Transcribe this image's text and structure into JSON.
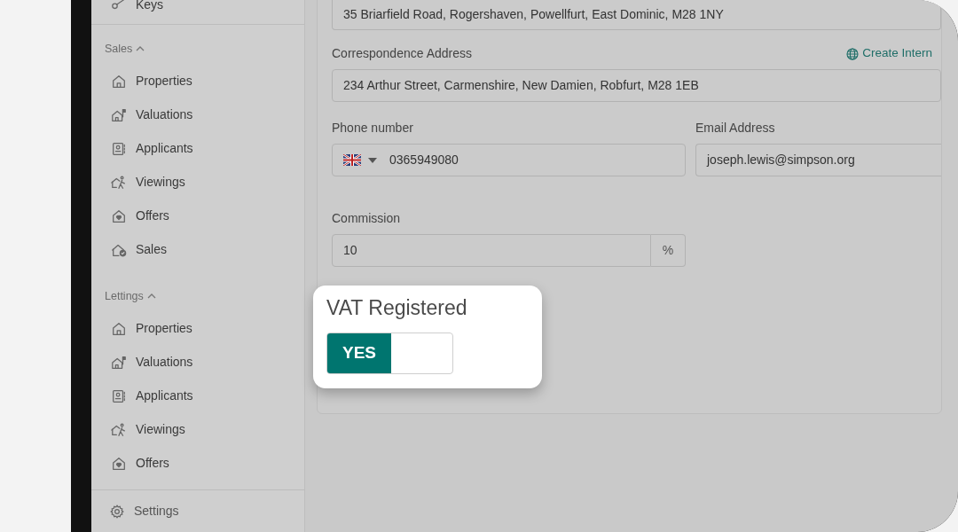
{
  "sidebar": {
    "top_item": {
      "label": "Keys"
    },
    "sections": [
      {
        "title": "Sales",
        "expanded": true,
        "items": [
          {
            "label": "Properties"
          },
          {
            "label": "Valuations"
          },
          {
            "label": "Applicants"
          },
          {
            "label": "Viewings"
          },
          {
            "label": "Offers"
          },
          {
            "label": "Sales"
          }
        ]
      },
      {
        "title": "Lettings",
        "expanded": true,
        "items": [
          {
            "label": "Properties"
          },
          {
            "label": "Valuations"
          },
          {
            "label": "Applicants"
          },
          {
            "label": "Viewings"
          },
          {
            "label": "Offers"
          }
        ]
      }
    ],
    "footer": {
      "label": "Settings"
    }
  },
  "form": {
    "address_value": "35 Briarfield Road, Rogershaven, Powellfurt, East Dominic, M28 1NY",
    "correspondence": {
      "label": "Correspondence Address",
      "link": "Create Intern",
      "value": "234 Arthur Street, Carmenshire, New Damien, Robfurt, M28 1EB"
    },
    "phone": {
      "label": "Phone number",
      "value": "0365949080"
    },
    "email": {
      "label": "Email Address",
      "value": "joseph.lewis@simpson.org"
    },
    "commission": {
      "label": "Commission",
      "value": "10",
      "suffix": "%"
    }
  },
  "vat": {
    "label": "VAT Registered",
    "on": true,
    "on_text": "YES"
  }
}
